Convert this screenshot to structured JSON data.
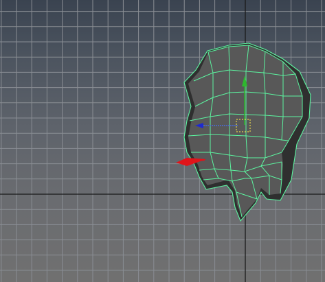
{
  "viewport": {
    "view": "side-orthographic",
    "grid_visible": true,
    "colors": {
      "background_top": "#3a4350",
      "background_bottom": "#707070",
      "grid_line": "#8a8e94",
      "grid_axis": "#1a1a1a",
      "wireframe": "#5cf5a0",
      "mesh_fill": "#575757",
      "mesh_shadow": "#2f2f2f",
      "gizmo_x": "#e0141a",
      "gizmo_y": "#2eb82e",
      "gizmo_z": "#1e2ad0",
      "gizmo_center": "#e8d84a"
    },
    "icons": [
      "move-manipulator-icon"
    ]
  },
  "selection": {
    "object": "head-mesh",
    "tool": "move-tool",
    "selected": true
  }
}
